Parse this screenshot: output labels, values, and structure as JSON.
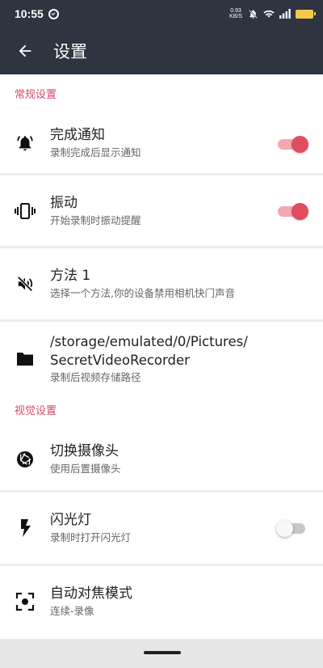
{
  "status_bar": {
    "time": "10:55",
    "net_speed_value": "0.93",
    "net_speed_unit": "KB/S"
  },
  "app_bar": {
    "title": "设置",
    "back_icon": "arrow-back-icon"
  },
  "sections": {
    "general": {
      "header": "常规设置",
      "items": [
        {
          "title": "完成通知",
          "subtitle": "录制完成后显示通知",
          "icon": "bell-icon",
          "toggle": true
        },
        {
          "title": "振动",
          "subtitle": "开始录制时振动提醒",
          "icon": "vibration-icon",
          "toggle": true
        },
        {
          "title": "方法 1",
          "subtitle": "选择一个方法,你的设备禁用相机快门声音",
          "icon": "volume-off-icon"
        },
        {
          "title_line1": "/storage/emulated/0/Pictures/",
          "title_line2": "SecretVideoRecorder",
          "subtitle": "录制后视频存储路径",
          "icon": "folder-icon"
        }
      ]
    },
    "visual": {
      "header": "视觉设置",
      "items": [
        {
          "title": "切换摄像头",
          "subtitle": "使用后置摄像头",
          "icon": "camera-shutter-icon"
        },
        {
          "title": "闪光灯",
          "subtitle": "录制时打开闪光灯",
          "icon": "flash-icon",
          "toggle": false
        },
        {
          "title": "自动对焦模式",
          "subtitle": "连续-录像",
          "icon": "focus-icon"
        }
      ]
    }
  },
  "colors": {
    "app_bar": "#2e3440",
    "accent": "#e04d5f",
    "section_header": "#d64a6b"
  }
}
